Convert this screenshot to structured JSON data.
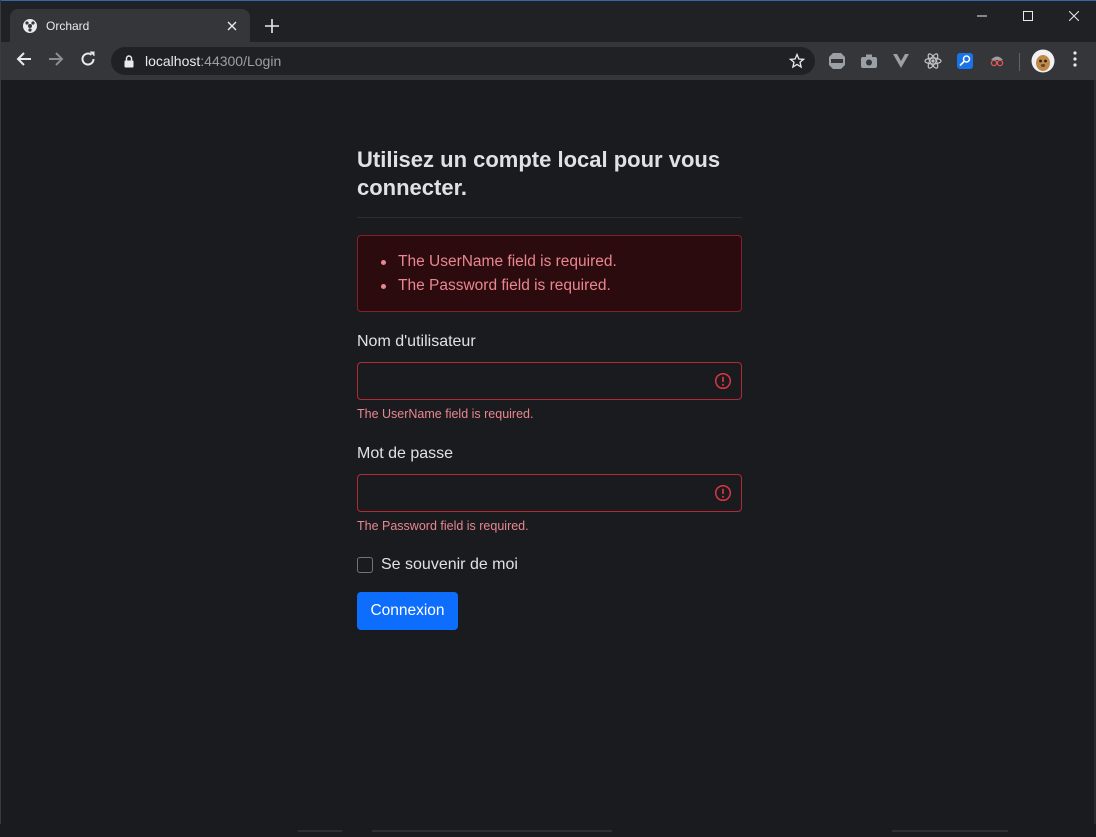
{
  "browser": {
    "tab": {
      "title": "Orchard",
      "favicon": "orchard-logo-icon"
    },
    "omnibox": {
      "host": "localhost",
      "path": ":44300/Login"
    },
    "extensions": [
      "adblock-icon",
      "camera-icon",
      "vue-devtools-icon",
      "react-devtools-icon",
      "key-icon",
      "spy-icon"
    ],
    "colors": {
      "accent": "#0d6efd",
      "error": "#ea868f",
      "error_border": "#b02a37",
      "alert_bg": "#2c0b0e"
    }
  },
  "login": {
    "heading": "Utilisez un compte local pour vous connecter.",
    "summary_errors": [
      "The UserName field is required.",
      "The Password field is required."
    ],
    "username": {
      "label": "Nom d'utilisateur",
      "value": "",
      "error": "The UserName field is required."
    },
    "password": {
      "label": "Mot de passe",
      "value": "",
      "error": "The Password field is required."
    },
    "remember_label": "Se souvenir de moi",
    "submit_label": "Connexion"
  }
}
